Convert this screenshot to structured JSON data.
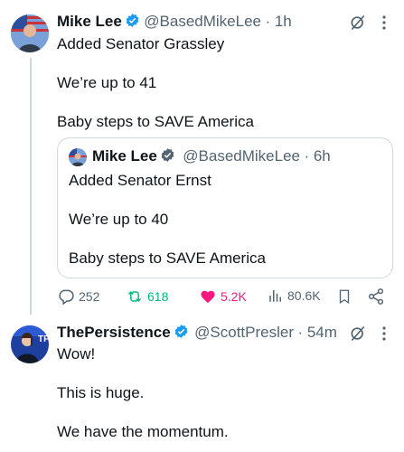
{
  "tweet1": {
    "name": "Mike Lee",
    "handle": "@BasedMikeLee",
    "time": "· 1h",
    "lines": [
      "Added Senator Grassley",
      "We’re up to 41",
      "Baby steps to SAVE America"
    ]
  },
  "quote": {
    "name": "Mike Lee",
    "handle": "@BasedMikeLee",
    "time": "· 6h",
    "lines": [
      "Added Senator Ernst",
      "We’re up to 40",
      "Baby steps to SAVE America"
    ]
  },
  "actions": {
    "replies": "252",
    "reposts": "618",
    "likes": "5.2K",
    "views": "80.6K"
  },
  "tweet2": {
    "name": "ThePersistence",
    "handle": "@ScottPresler",
    "time": "· 54m",
    "lines": [
      "Wow!",
      "This is huge.",
      "We have the momentum."
    ]
  },
  "colors": {
    "verified": "#1d9bf0",
    "repost": "#00ba7c",
    "like": "#f91880",
    "muted": "#536471"
  }
}
